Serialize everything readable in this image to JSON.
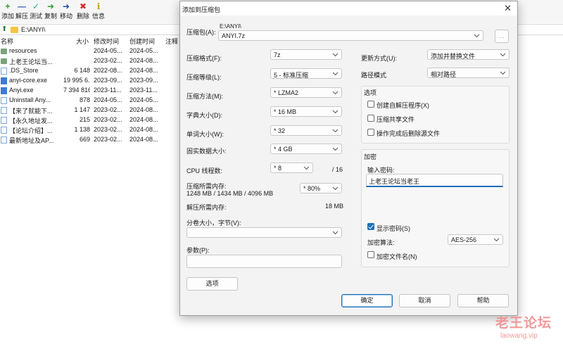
{
  "toolbar": {
    "items": [
      {
        "label": "添加",
        "glyph": "+",
        "color": "#2e9d2e"
      },
      {
        "label": "解压",
        "glyph": "—",
        "color": "#2b5fb0"
      },
      {
        "label": "测试",
        "glyph": "✓",
        "color": "#26a69a"
      },
      {
        "label": "复制",
        "glyph": "➜",
        "color": "#2e9d2e"
      },
      {
        "label": "移动",
        "glyph": "➜",
        "color": "#1f4fa8"
      },
      {
        "label": "删除",
        "glyph": "✖",
        "color": "#d32f2f"
      },
      {
        "label": "信息",
        "glyph": "ℹ",
        "color": "#c79a1a"
      }
    ]
  },
  "pathbar": {
    "path": "E:\\ANYI\\"
  },
  "columns": {
    "name": "名称",
    "size": "大小",
    "modified": "修改时间",
    "created": "创建时间",
    "comment": "注释"
  },
  "files": [
    {
      "name": "resources",
      "size": "",
      "modified": "2024-05...",
      "created": "2024-05...",
      "icon": "folder"
    },
    {
      "name": "上老王论坛当...",
      "size": "",
      "modified": "2023-02...",
      "created": "2024-08...",
      "icon": "folder"
    },
    {
      "name": ".DS_Store",
      "size": "6 148",
      "modified": "2022-08...",
      "created": "2024-08...",
      "icon": "file"
    },
    {
      "name": "anyi-core.exe",
      "size": "19 995 6...",
      "modified": "2023-09...",
      "created": "2023-09...",
      "icon": "exe"
    },
    {
      "name": "Anyi.exe",
      "size": "7 394 816",
      "modified": "2023-11...",
      "created": "2023-11...",
      "icon": "exe"
    },
    {
      "name": "Uninstall Any...",
      "size": "878",
      "modified": "2024-05...",
      "created": "2024-05...",
      "icon": "file"
    },
    {
      "name": "【来了就能下...",
      "size": "1 147",
      "modified": "2023-02...",
      "created": "2024-08...",
      "icon": "file"
    },
    {
      "name": "【永久地址发...",
      "size": "215",
      "modified": "2023-02...",
      "created": "2024-08...",
      "icon": "file"
    },
    {
      "name": "【论坛介绍】...",
      "size": "1 138",
      "modified": "2023-02...",
      "created": "2024-08...",
      "icon": "file"
    },
    {
      "name": "最新地址及AP...",
      "size": "669",
      "modified": "2023-02...",
      "created": "2024-08...",
      "icon": "file"
    }
  ],
  "dialog": {
    "title": "添加到压缩包",
    "archive_label": "压缩包(A):",
    "archive_dir": "E:\\ANYI\\",
    "archive_name": "ANYI.7z",
    "browse_label": "...",
    "format_label": "压缩格式(F):",
    "format_value": "7z",
    "level_label": "压缩等级(L):",
    "level_value": "5 - 标准压缩",
    "method_label": "压缩方法(M):",
    "method_value": "* LZMA2",
    "dict_label": "字典大小(D):",
    "dict_value": "* 16 MB",
    "word_label": "单词大小(W):",
    "word_value": "* 32",
    "solid_label": "固实数据大小:",
    "solid_value": "* 4 GB",
    "cpu_label": "CPU 线程数:",
    "cpu_value": "* 8",
    "cpu_max": "/ 16",
    "mem_label": "压缩所需内存:",
    "mem_detail": "1248 MB / 1434 MB / 4096 MB",
    "mem_value": "* 80%",
    "decomp_label": "解压所需内存:",
    "decomp_value": "18 MB",
    "split_label": "分卷大小，字节(V):",
    "split_value": "",
    "params_label": "参数(P):",
    "params_value": "",
    "options_button": "选项",
    "update_label": "更新方式(U):",
    "update_value": "添加并替换文件",
    "pathmode_label": "路径模式",
    "pathmode_value": "相对路径",
    "options_group": "选项",
    "opt_sfx": "创建自解压程序(X)",
    "opt_shared": "压缩共享文件",
    "opt_delete": "操作完成后删除源文件",
    "encrypt_group": "加密",
    "password_label": "输入密码:",
    "password_value": "上老王论坛当老王",
    "show_password": "显示密码(S)",
    "enc_method_label": "加密算法:",
    "enc_method_value": "AES-256",
    "encrypt_names": "加密文件名(N)",
    "ok": "确定",
    "cancel": "取消",
    "help": "帮助"
  },
  "watermark": {
    "line1": "老王论坛",
    "line2": "laowang.vip"
  }
}
